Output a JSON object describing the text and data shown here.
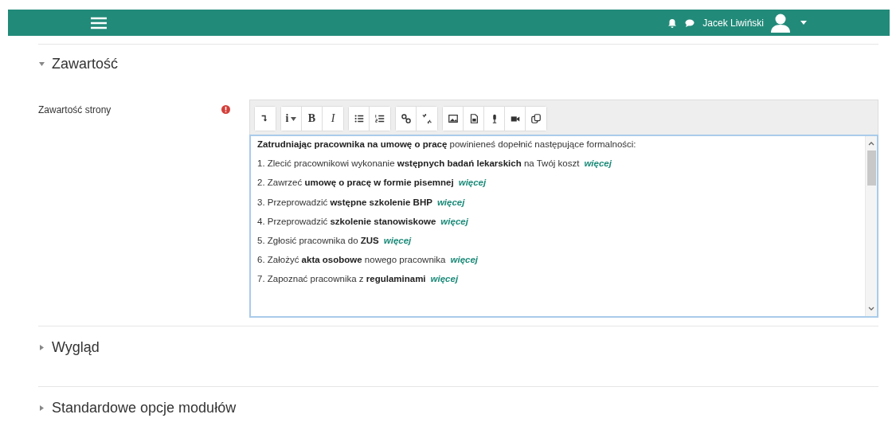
{
  "navbar": {
    "user_name": "Jacek Liwiński"
  },
  "sections": [
    {
      "title": "Zawartość",
      "expanded": true
    },
    {
      "title": "Wygląd",
      "expanded": false
    },
    {
      "title": "Standardowe opcje modułów",
      "expanded": false
    }
  ],
  "field": {
    "label": "Zawartość strony",
    "required": true
  },
  "toolbar": [
    [
      {
        "kind": "collapse"
      }
    ],
    [
      {
        "kind": "style-menu",
        "label": "i"
      },
      {
        "kind": "bold",
        "label": "B"
      },
      {
        "kind": "italic",
        "label": "I"
      }
    ],
    [
      {
        "kind": "bullets"
      },
      {
        "kind": "numbers"
      }
    ],
    [
      {
        "kind": "link"
      },
      {
        "kind": "unlink"
      }
    ],
    [
      {
        "kind": "image"
      },
      {
        "kind": "media"
      },
      {
        "kind": "mic"
      },
      {
        "kind": "video"
      },
      {
        "kind": "copy"
      }
    ]
  ],
  "content": [
    {
      "text": "**Zatrudniając pracownika na umowę o pracę** powinieneś dopełnić następujące formalności:"
    },
    {
      "text": "1. Zlecić pracownikowi wykonanie **wstępnych badań lekarskich** na Twój koszt",
      "link": "więcej"
    },
    {
      "text": "2. Zawrzeć **umowę o pracę w formie pisemnej**",
      "link": "więcej"
    },
    {
      "text": "3. Przeprowadzić **wstępne szkolenie BHP**",
      "link": "więcej"
    },
    {
      "text": "4. Przeprowadzić **szkolenie stanowiskowe**",
      "link": "więcej"
    },
    {
      "text": "5. Zgłosić pracownika do **ZUS**",
      "link": "więcej"
    },
    {
      "text": "6. Założyć **akta osobowe** nowego pracownika",
      "link": "więcej"
    },
    {
      "text": "7. Zapoznać pracownika z **regulaminami**",
      "link": "więcej"
    }
  ]
}
